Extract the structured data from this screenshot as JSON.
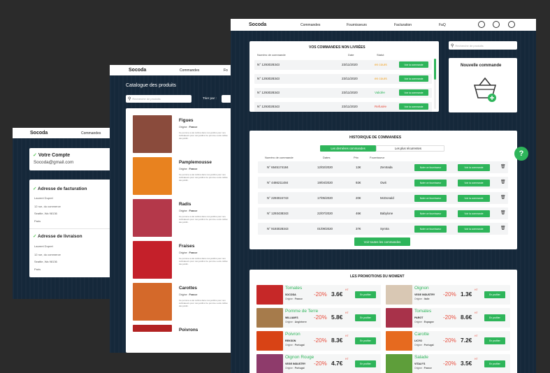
{
  "brand": "Socoda",
  "s1": {
    "nav": [
      "Commandes"
    ],
    "account_title": "Votre Compte",
    "email": "Socoda@gmail.com",
    "billing_title": "Adresse de facturation",
    "billing": [
      "Laurent Dupret",
      "12 rue, du commerce",
      "Seattle, Wa 98136",
      "Paris"
    ],
    "delivery_title": "Adresse de livraison",
    "delivery": [
      "Laurent Dupret",
      "12 rue, du commerce",
      "Seattle, Wa 98136",
      "Paris"
    ]
  },
  "s2": {
    "nav": [
      "Commandes",
      "Fo"
    ],
    "title": "Catalogue des produits",
    "search_placeholder": "Recherche de produits",
    "sort_label": "Trier par :",
    "origin_label": "Origine :",
    "origin_value": "France",
    "desc": "Ce pomme a été cultivé dans nos jardins pour nos cultivateurs pour nos jardins Ce pomme a été cultivé des jardin.",
    "products": [
      "Figues",
      "Pamplemousse",
      "Radis",
      "Fraises",
      "Carottes",
      "Poivrons"
    ],
    "product_colors": [
      "#8a4b3c",
      "#e8821f",
      "#b4384a",
      "#c4202a",
      "#d4692a",
      "#b22222"
    ]
  },
  "s3": {
    "nav": [
      "Commandes",
      "Fournisseurs",
      "Facturation",
      "FaQ"
    ],
    "search_placeholder": "Recherche de produits",
    "pending": {
      "title": "VOS COMMANDES NON LIVRÉES",
      "headers": [
        "Numéro de commande",
        "Date",
        "Statut"
      ],
      "rows": [
        {
          "num": "N° 1293028343",
          "date": "23/11/2020",
          "status": "en cours",
          "color": "#f39c12"
        },
        {
          "num": "N° 1293028343",
          "date": "23/11/2020",
          "status": "en cours",
          "color": "#f39c12"
        },
        {
          "num": "N° 1293028343",
          "date": "23/11/2020",
          "status": "Validée",
          "color": "#2eb55a"
        },
        {
          "num": "N° 1293028343",
          "date": "23/11/2020",
          "status": "Refusée",
          "color": "#e74c3c"
        }
      ],
      "btn": "Voir la commande"
    },
    "new_order": "Nouvelle commande",
    "history": {
      "title": "HISTORIQUE DE COMMANDES",
      "tab_active": "Les dernières commandes",
      "tab_other": "Les plus récurrentes",
      "headers": [
        "Numéro de commande",
        "Dates",
        "Prix",
        "Fournisseur"
      ],
      "rows": [
        {
          "num": "N° 6545174184",
          "date": "12/02/2020",
          "price": "12€",
          "supplier": "Zentrada"
        },
        {
          "num": "N° 4486211484",
          "date": "19/04/2020",
          "price": "92€",
          "supplier": "Owit"
        },
        {
          "num": "N° 2293024743",
          "date": "17/05/2020",
          "price": "20€",
          "supplier": "McDonald"
        },
        {
          "num": "N° 1293438343",
          "date": "22/07/2020",
          "price": "46€",
          "supplier": "Babylone"
        },
        {
          "num": "N° 9193028343",
          "date": "01/09/2020",
          "price": "37€",
          "supplier": "Syntra"
        }
      ],
      "btn_supplier": "Noter ce fournisseur",
      "btn_order": "Voir la commande",
      "btn_all": "Voir toutes les commandes"
    },
    "promos": {
      "title": "LES PROMOTIONS DU MOMENT",
      "origin_label": "Origine :",
      "ht": "HT",
      "btn": "En profiter",
      "items": [
        {
          "name": "Tomates",
          "supplier": "SOCODA",
          "origin": "France",
          "pct": "-20%",
          "price": "3.6€",
          "color": "#c62828"
        },
        {
          "name": "Oignon",
          "supplier": "VEGE INDUSTRY",
          "origin": "Italie",
          "pct": "-20%",
          "price": "1.3€",
          "color": "#d9c8b4"
        },
        {
          "name": "Pomme de Terre",
          "supplier": "WILLIAM'S",
          "origin": "Angleterre",
          "pct": "-20%",
          "price": "5.8€",
          "color": "#a67b4b"
        },
        {
          "name": "Tomates",
          "supplier": "PAROT",
          "origin": "Espagne",
          "pct": "-20%",
          "price": "8.6€",
          "color": "#a8324a"
        },
        {
          "name": "Poivron",
          "supplier": "REKSON",
          "origin": "Portugal",
          "pct": "-20%",
          "price": "8.3€",
          "color": "#d84315"
        },
        {
          "name": "Carotte",
          "supplier": "LICYO",
          "origin": "Portugal",
          "pct": "-20%",
          "price": "7.2€",
          "color": "#e66a1f"
        },
        {
          "name": "Oignon Rouge",
          "supplier": "VEGE INDUSTRY",
          "origin": "Portugal",
          "pct": "-20%",
          "price": "4.7€",
          "color": "#8e3b6b"
        },
        {
          "name": "Salade",
          "supplier": "VITALY'S",
          "origin": "France",
          "pct": "-20%",
          "price": "3.5€",
          "color": "#5e9e3a"
        }
      ]
    },
    "help": "?"
  }
}
